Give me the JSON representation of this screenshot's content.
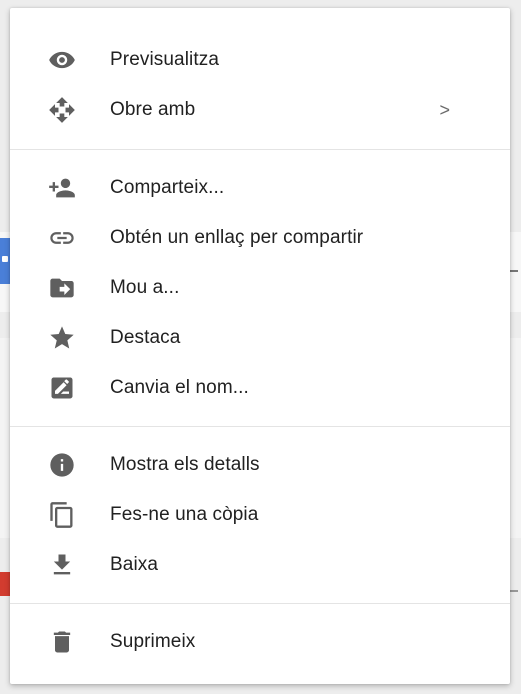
{
  "menu": {
    "groups": [
      {
        "items": [
          {
            "id": "preview",
            "label": "Previsualitza",
            "icon": "eye-icon"
          },
          {
            "id": "open-with",
            "label": "Obre amb",
            "icon": "move-arrows-icon",
            "submenu_indicator": ">"
          }
        ]
      },
      {
        "items": [
          {
            "id": "share",
            "label": "Comparteix...",
            "icon": "person-add-icon"
          },
          {
            "id": "get-link",
            "label": "Obtén un enllaç per compartir",
            "icon": "link-icon"
          },
          {
            "id": "move-to",
            "label": "Mou a...",
            "icon": "folder-move-icon"
          },
          {
            "id": "star",
            "label": "Destaca",
            "icon": "star-icon"
          },
          {
            "id": "rename",
            "label": "Canvia el nom...",
            "icon": "rename-pencil-icon"
          }
        ]
      },
      {
        "items": [
          {
            "id": "details",
            "label": "Mostra els detalls",
            "icon": "info-icon"
          },
          {
            "id": "copy",
            "label": "Fes-ne una còpia",
            "icon": "copy-icon"
          },
          {
            "id": "download",
            "label": "Baixa",
            "icon": "download-icon"
          }
        ]
      },
      {
        "items": [
          {
            "id": "delete",
            "label": "Suprimeix",
            "icon": "trash-icon"
          }
        ]
      }
    ]
  },
  "colors": {
    "icon": "#5f5f5f",
    "text": "#212121",
    "divider": "#e4e4e4",
    "menu_bg": "#ffffff"
  }
}
